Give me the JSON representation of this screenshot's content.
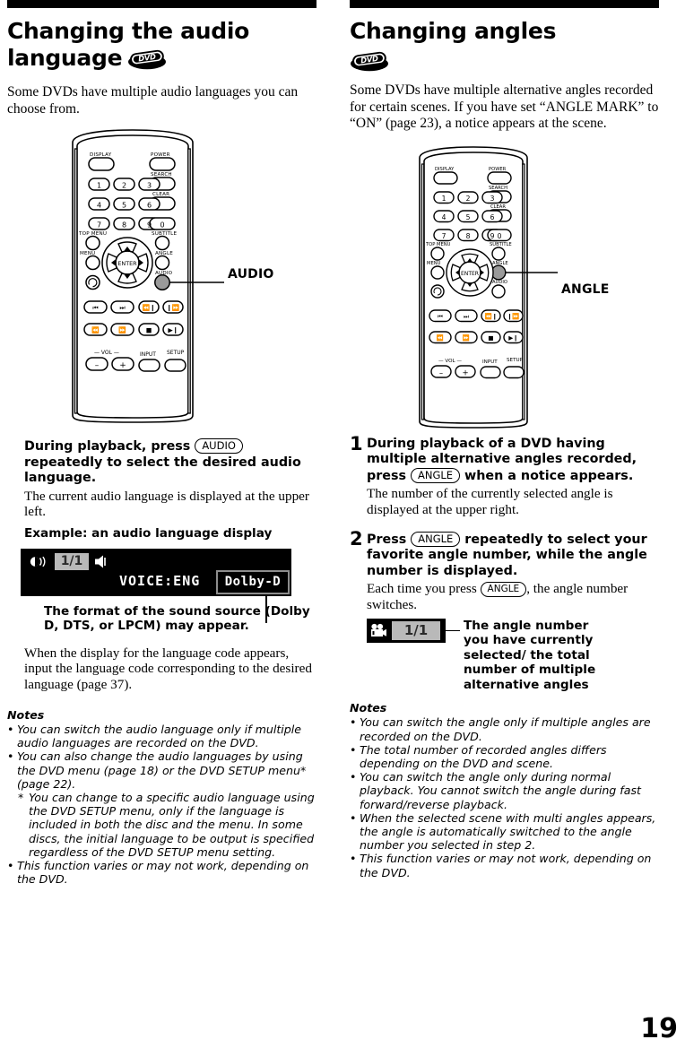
{
  "page_number": "19",
  "left": {
    "title_line1": "Changing the audio",
    "title_line2": "language",
    "disc_badge": "DVD",
    "intro": "Some DVDs have multiple audio languages you can choose from.",
    "remote": {
      "callout": "AUDIO",
      "labels": {
        "display": "DISPLAY",
        "power": "POWER",
        "search": "SEARCH",
        "clear": "CLEAR",
        "top_menu": "TOP MENU",
        "subtitle": "SUBTITLE",
        "menu": "MENU",
        "angle": "ANGLE",
        "audio": "AUDIO",
        "enter": "ENTER",
        "vol": "VOL",
        "input": "INPUT",
        "setup": "SETUP",
        "vol_minus": "–",
        "vol_plus": "+"
      },
      "numbers": [
        "1",
        "2",
        "3",
        "4",
        "5",
        "6",
        "7",
        "8",
        "9",
        "0"
      ],
      "highlighted_button": "AUDIO"
    },
    "instruction_bold_a": "During playback, press",
    "instruction_key": "AUDIO",
    "instruction_bold_b": "repeatedly to select the desired audio language.",
    "instruction_sub": "The current audio language is displayed at the upper left.",
    "example_label": "Example: an audio language display",
    "osd": {
      "angle_counter": "1/1",
      "voice": "VOICE:ENG",
      "format": "Dolby-D"
    },
    "osd_caption": "The format of the sound source (Dolby D, DTS, or LPCM) may appear.",
    "after_text": "When the display for the language code appears, input the language code corresponding to the desired language (page 37).",
    "notes_title": "Notes",
    "notes": [
      {
        "bullet": "•",
        "text": "You can switch the audio language only if multiple audio languages are recorded on the DVD."
      },
      {
        "bullet": "•",
        "text": "You can also change the audio languages by using the DVD menu (page 18) or the DVD SETUP menu* (page 22)."
      },
      {
        "bullet": "*",
        "sub": true,
        "text": "You can change to a specific audio language using the DVD SETUP menu, only if the language is included in both the disc and the menu. In some discs, the initial language to be output is specified regardless of the DVD SETUP menu setting."
      },
      {
        "bullet": "•",
        "text": "This function varies or may not work, depending on the DVD."
      }
    ]
  },
  "right": {
    "title_line1": "Changing angles",
    "disc_badge": "DVD",
    "intro": "Some DVDs have multiple alternative angles recorded for certain scenes. If you have set “ANGLE MARK” to “ON” (page 23), a notice appears at the scene.",
    "remote": {
      "callout": "ANGLE",
      "labels": {
        "display": "DISPLAY",
        "power": "POWER",
        "search": "SEARCH",
        "clear": "CLEAR",
        "top_menu": "TOP MENU",
        "subtitle": "SUBTITLE",
        "menu": "MENU",
        "angle": "ANGLE",
        "audio": "AUDIO",
        "enter": "ENTER",
        "vol": "VOL",
        "input": "INPUT",
        "setup": "SETUP",
        "vol_minus": "–",
        "vol_plus": "+"
      },
      "numbers": [
        "1",
        "2",
        "3",
        "4",
        "5",
        "6",
        "7",
        "8",
        "9",
        "0"
      ],
      "highlighted_button": "ANGLE"
    },
    "steps": [
      {
        "num": "1",
        "bold_a": "During playback of a DVD having multiple alternative angles recorded, press",
        "key": "ANGLE",
        "bold_b": "when a notice appears.",
        "sub": "The number of the currently selected angle is displayed at the upper right."
      },
      {
        "num": "2",
        "bold_a": "Press",
        "key": "ANGLE",
        "bold_b": "repeatedly to select your favorite angle number, while the angle number is displayed.",
        "sub_a": "Each time you press",
        "sub_key": "ANGLE",
        "sub_b": ", the angle number switches."
      }
    ],
    "osd": {
      "angle_counter": "1/1"
    },
    "osd_caption": "The angle number you have currently selected/ the total number of multiple alternative angles",
    "notes_title": "Notes",
    "notes": [
      {
        "bullet": "•",
        "text": "You can switch the angle only if multiple angles are recorded on the DVD."
      },
      {
        "bullet": "•",
        "text": "The total number of recorded angles differs depending on the DVD and scene."
      },
      {
        "bullet": "•",
        "text": "You can switch the angle only during normal playback. You cannot switch the angle during fast forward/reverse playback."
      },
      {
        "bullet": "•",
        "text": "When the selected scene with multi angles appears, the angle is automatically switched to the angle number you selected in step 2."
      },
      {
        "bullet": "•",
        "text": "This function varies or may not work, depending on the DVD."
      }
    ]
  }
}
